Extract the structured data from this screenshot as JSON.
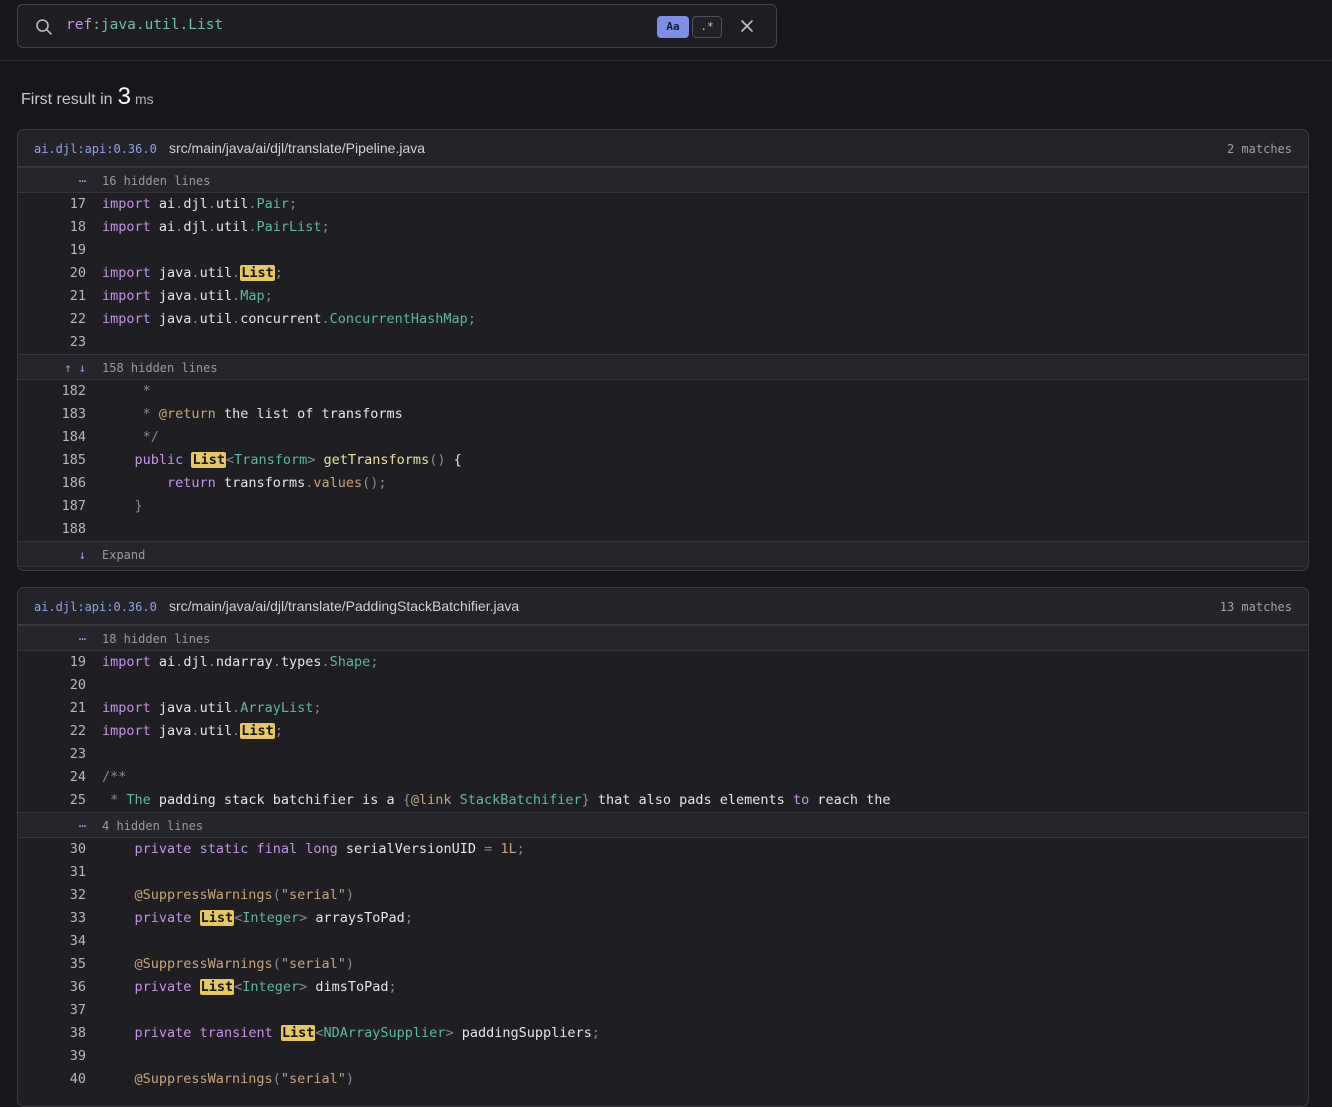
{
  "search": {
    "query_prefix": "ref",
    "query_value": ":java.util.List",
    "case_toggle_label": "Aa",
    "regex_toggle_label": ".*"
  },
  "timing": {
    "prefix": "First result in",
    "value": "3",
    "unit": "ms"
  },
  "results": [
    {
      "package": "ai.djl:api:0.36.0",
      "path": "src/main/java/ai/djl/translate/Pipeline.java",
      "matches": "2 matches",
      "hidden1": "16 hidden lines",
      "hidden2": "158 hidden lines",
      "expand": "Expand",
      "lines1": [
        "17",
        "18",
        "19",
        "20",
        "21",
        "22",
        "23"
      ],
      "lines2": [
        "182",
        "183",
        "184",
        "185",
        "186",
        "187",
        "188"
      ]
    },
    {
      "package": "ai.djl:api:0.36.0",
      "path": "src/main/java/ai/djl/translate/PaddingStackBatchifier.java",
      "matches": "13 matches",
      "hidden1": "18 hidden lines",
      "hidden2": "4 hidden lines",
      "lines1": [
        "19",
        "20",
        "21",
        "22",
        "23",
        "24",
        "25"
      ],
      "lines2": [
        "30",
        "31",
        "32",
        "33",
        "34",
        "35",
        "36",
        "37",
        "38",
        "39",
        "40"
      ]
    }
  ]
}
